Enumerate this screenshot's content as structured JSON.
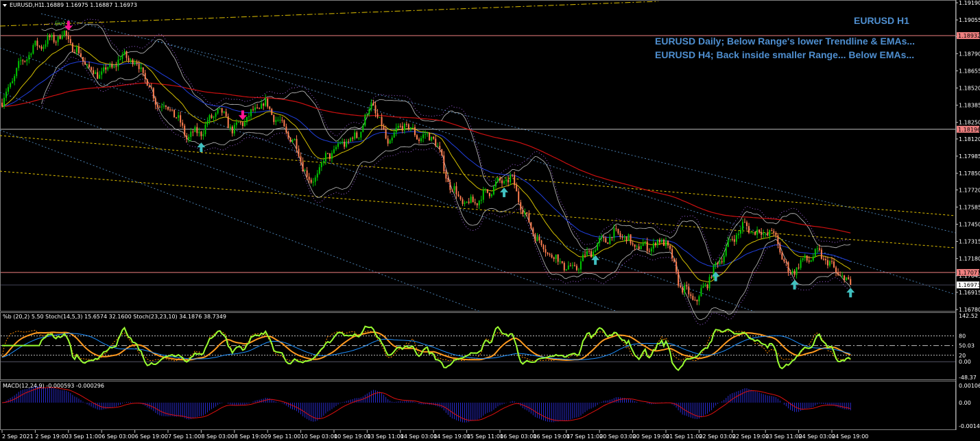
{
  "header": {
    "symbol": "EURUSD,H1",
    "ohlc": "1.16889 1.16975 1.16887 1.16973",
    "stoch_pane_label": "%b (20,2) 5.50  Stoch(14,5,3) 15.6574 32.1600  Stoch(23,23,10) 34.1876 38.7349",
    "macd_pane_label": "MACD(12,24,9) -0.000593 -0.000296"
  },
  "annotations": {
    "title": "EURUSD H1",
    "line1": "EURUSD Daily; Below Range's lower Trendline & EMAs...",
    "line2": "EURUSD H4; Back inside smaller Range... Below EMAs..."
  },
  "colors": {
    "background": "#000000",
    "bull": "#00c800",
    "bear": "#ff7f50",
    "ema_fast": "#d4c000",
    "ema_mid": "#2040e0",
    "ema_slow": "#d01010",
    "bands": "#c0c0c0",
    "sell_arrow": "#ff1493",
    "buy_arrow": "#40c0c0",
    "annotation": "#4f8fd0",
    "level_line": "#f08080"
  },
  "chart_data": [
    {
      "type": "candlestick",
      "title": "EURUSD,H1",
      "ylim": [
        1.1678,
        1.1919
      ],
      "y_ticks": [
        "1.19190",
        "1.19055",
        "1.18925",
        "1.18790",
        "1.18655",
        "1.18520",
        "1.18385",
        "1.18250",
        "1.18120",
        "1.17985",
        "1.17850",
        "1.17720",
        "1.17585",
        "1.17450",
        "1.17315",
        "1.17180",
        "1.17045",
        "1.16915",
        "1.16780"
      ],
      "x_ticks": [
        "2 Sep 2021",
        "2 Sep 19:00",
        "3 Sep 11:00",
        "6 Sep 03:00",
        "6 Sep 19:00",
        "7 Sep 11:00",
        "8 Sep 03:00",
        "8 Sep 19:00",
        "9 Sep 11:00",
        "10 Sep 03:00",
        "10 Sep 19:00",
        "13 Sep 11:00",
        "14 Sep 03:00",
        "14 Sep 19:00",
        "15 Sep 11:00",
        "16 Sep 03:00",
        "16 Sep 19:00",
        "17 Sep 11:00",
        "20 Sep 03:00",
        "20 Sep 19:00",
        "21 Sep 11:00",
        "22 Sep 03:00",
        "22 Sep 19:00",
        "23 Sep 11:00",
        "24 Sep 03:00",
        "24 Sep 19:00"
      ],
      "approx_close_path": [
        1.18405,
        1.18674,
        1.18835,
        1.18889,
        1.18943,
        1.18781,
        1.1862,
        1.18674,
        1.18781,
        1.18674,
        1.18405,
        1.18351,
        1.18136,
        1.18189,
        1.18351,
        1.18189,
        1.18297,
        1.18405,
        1.18243,
        1.18082,
        1.17759,
        1.17974,
        1.18082,
        1.18136,
        1.18405,
        1.18082,
        1.18243,
        1.18136,
        1.18136,
        1.17759,
        1.17598,
        1.17651,
        1.17759,
        1.17813,
        1.1749,
        1.17275,
        1.17167,
        1.17086,
        1.17221,
        1.17329,
        1.17382,
        1.17275,
        1.17275,
        1.17329,
        1.16952,
        1.16844,
        1.17059,
        1.17275,
        1.17436,
        1.17382,
        1.17382,
        1.17059,
        1.17167,
        1.17221,
        1.17086,
        1.16973
      ],
      "price_levels": [
        {
          "label": "1.18932",
          "value": 1.18932,
          "style": "level"
        },
        {
          "label": "1.18196",
          "value": 1.18196,
          "style": "level"
        },
        {
          "label": "1.17071",
          "value": 1.17071,
          "style": "level"
        },
        {
          "label": "1.16973",
          "value": 1.16973,
          "style": "current"
        }
      ],
      "signals": [
        {
          "type": "sell",
          "x_tick": "3 Sep 11:00",
          "offset_hours": 0
        },
        {
          "type": "sell",
          "x_tick": "8 Sep 19:00",
          "offset_hours": 4
        },
        {
          "type": "buy",
          "x_tick": "8 Sep 03:00",
          "offset_hours": 0
        },
        {
          "type": "buy",
          "x_tick": "16 Sep 03:00",
          "offset_hours": 2
        },
        {
          "type": "buy",
          "x_tick": "20 Sep 03:00",
          "offset_hours": -2
        },
        {
          "type": "buy",
          "x_tick": "22 Sep 03:00",
          "offset_hours": 8
        },
        {
          "type": "buy",
          "x_tick": "24 Sep 03:00",
          "offset_hours": -2
        },
        {
          "type": "buy",
          "x_tick": "24 Sep 19:00",
          "offset_hours": 9
        }
      ],
      "wave_label": "(iv)"
    },
    {
      "type": "line",
      "title": "%b (20,2) 5.50  Stoch(14,5,3) 15.6574 32.1600  Stoch(23,23,10) 34.1876 38.7349",
      "ylim": [
        -48.37,
        142.52
      ],
      "y_ticks": [
        "142.52",
        "80",
        "50.03",
        "0.00",
        "20",
        "-48.37"
      ],
      "levels": [
        80,
        50.03,
        0,
        20
      ]
    },
    {
      "type": "bar",
      "title": "MACD(12,24,9) -0.000593 -0.000296",
      "ylim": [
        -0.00144,
        0.00106
      ],
      "y_ticks": [
        "0.00106",
        "0.00",
        "-0.00144"
      ]
    }
  ]
}
